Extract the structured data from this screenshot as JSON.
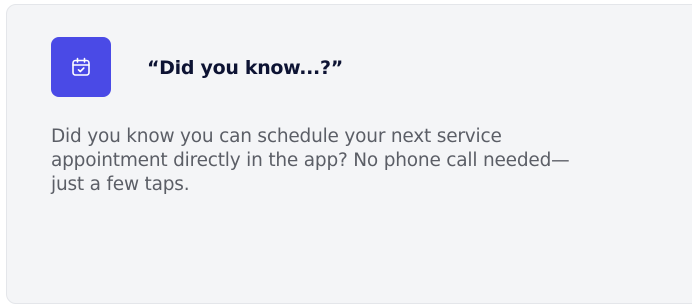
{
  "tip_card": {
    "icon": "calendar-check-icon",
    "accent_color": "#4a4ae6",
    "title": "“Did you know...?”",
    "body": "Did you know you can schedule your next service appointment directly in the app? No phone call needed—just a few taps."
  }
}
